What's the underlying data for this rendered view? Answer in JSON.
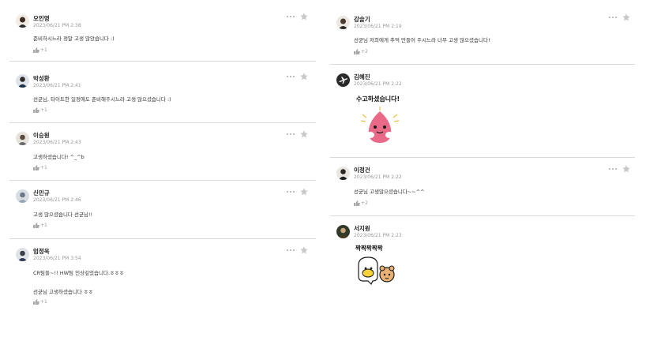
{
  "left_comments": [
    {
      "name": "오인영",
      "date": "2023/06/21 PM 2:38",
      "text": "준비하시느라 정말 고생 많았습니다 :)",
      "likes": "+1"
    },
    {
      "name": "박성환",
      "date": "2023/06/21 PM 2:41",
      "text": "선균님, 타이트한 일정에도 준비해주시느라 고생 많으셨습니다 :)",
      "likes": "+1"
    },
    {
      "name": "이승원",
      "date": "2023/06/21 PM 2:43",
      "text": "고생하셨습니다! ^_^b",
      "likes": "+1"
    },
    {
      "name": "신민규",
      "date": "2023/06/21 PM 2:46",
      "text": "고생 많으셨습니다 선균님!!",
      "likes": "+1"
    },
    {
      "name": "엄정욱",
      "date": "2023/06/21 PM 3:54",
      "text": "CR팀들~!! HW팀 인상깊었습니다.ㅎㅎㅎ",
      "text2": "선균님 고생하셨습니다 ㅎㅎ",
      "likes": "+1"
    }
  ],
  "right_comments": [
    {
      "name": "강슬기",
      "date": "2023/06/21 PM 2:19",
      "text": "선균님 저희에게 추억 만들어 주시느라 너무 고생 많으셨습니다!",
      "likes": "+2"
    },
    {
      "name": "김혜진",
      "date": "2023/06/21 PM 2:22",
      "sticker_text": "수고하셨습니다!"
    },
    {
      "name": "이정건",
      "date": "2023/06/21 PM 2:22",
      "text": "선균님 고생많으셨습니다~~^^",
      "likes": "+2"
    },
    {
      "name": "서지원",
      "date": "2023/06/21 PM 2:23",
      "sticker_text": "짝짝짝짝짝"
    }
  ],
  "icons": {
    "more": "more-dots-icon",
    "favorite": "star-icon",
    "like": "thumbs-up-icon"
  },
  "colors": {
    "star": "#c8c8c8",
    "divider": "#d9d9d9",
    "date": "#999999"
  }
}
